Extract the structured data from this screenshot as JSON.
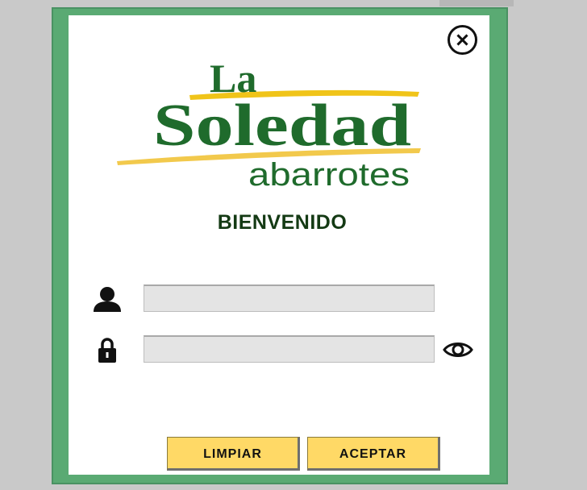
{
  "logo": {
    "word1": "La",
    "word2": "Soledad",
    "word3": "abarrotes",
    "colors": {
      "green": "#1f6b2c",
      "stripe": "#f0c419"
    }
  },
  "welcome_text": "BIENVENIDO",
  "username": {
    "value": "",
    "placeholder": ""
  },
  "password": {
    "value": "",
    "placeholder": ""
  },
  "buttons": {
    "clear": "LIMPIAR",
    "accept": "ACEPTAR"
  },
  "icons": {
    "close": "close-circle-icon",
    "user": "user-icon",
    "lock": "lock-icon",
    "eye": "eye-icon"
  },
  "colors": {
    "frame": "#5aaa73",
    "button": "#ffd966",
    "title": "#143a14"
  }
}
